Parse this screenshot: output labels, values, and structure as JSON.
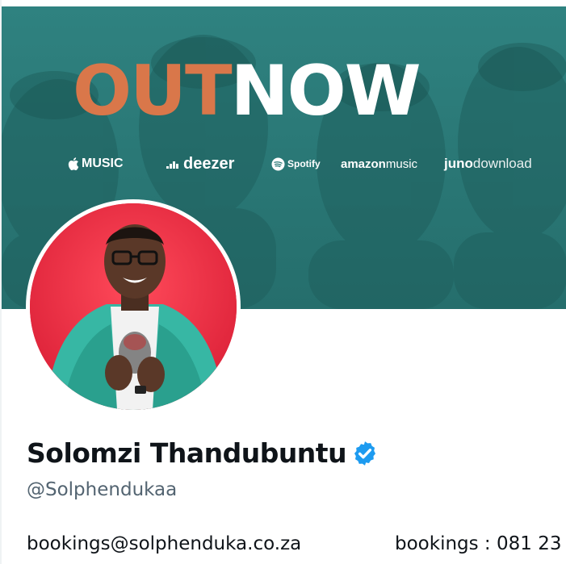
{
  "banner": {
    "headline_part1": "OUT",
    "headline_part2": "NOW",
    "platforms": {
      "apple_music": "MUSIC",
      "deezer": "deezer",
      "spotify": "Spotify",
      "amazon_music_1": "amazon",
      "amazon_music_2": "music",
      "juno_1": "juno",
      "juno_2": "download"
    },
    "colors": {
      "background": "#2b7a78",
      "out": "#d9774a",
      "now": "#ffffff"
    }
  },
  "profile": {
    "display_name": "Solomzi Thandubuntu",
    "handle": "@Solphendukaa",
    "verified": true,
    "avatar_background": "#e7233d",
    "bio_email": "bookings@solphenduka.co.za",
    "bio_phone": "bookings : 081 23"
  }
}
